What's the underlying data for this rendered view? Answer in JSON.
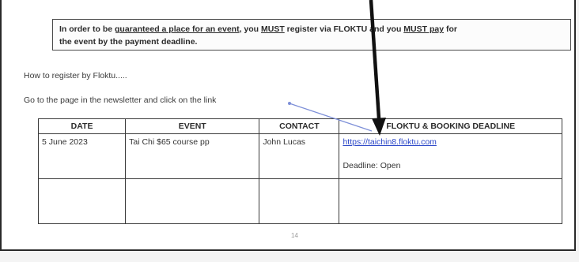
{
  "notice": {
    "t1": "In order to be ",
    "t2": "guaranteed a place for an event",
    "t3": ", you ",
    "t4": "MUST",
    "t5": " register via FLOKTU and you ",
    "t6": "MUST pay",
    "t7": " for",
    "t8": "the event by the payment deadline."
  },
  "intro": "How to register by Floktu.....",
  "instruction_prefix": "Go to the page in the newsletter and click on the ",
  "instruction_link": "link",
  "table": {
    "headers": [
      "DATE",
      "EVENT",
      "CONTACT",
      "FLOKTU & BOOKING DEADLINE"
    ],
    "rows": [
      {
        "date": "5 June 2023",
        "event": "Tai Chi $65 course pp",
        "contact": "John Lucas",
        "link": "https://taichin8.floktu.com",
        "deadline": "Deadline: Open"
      },
      {
        "date": "",
        "event": "",
        "contact": "",
        "link": "",
        "deadline": ""
      }
    ]
  },
  "page_number": "14",
  "colors": {
    "link": "#2a46c8",
    "arrow": "#111111",
    "pointer_line": "#7d8fd8"
  }
}
